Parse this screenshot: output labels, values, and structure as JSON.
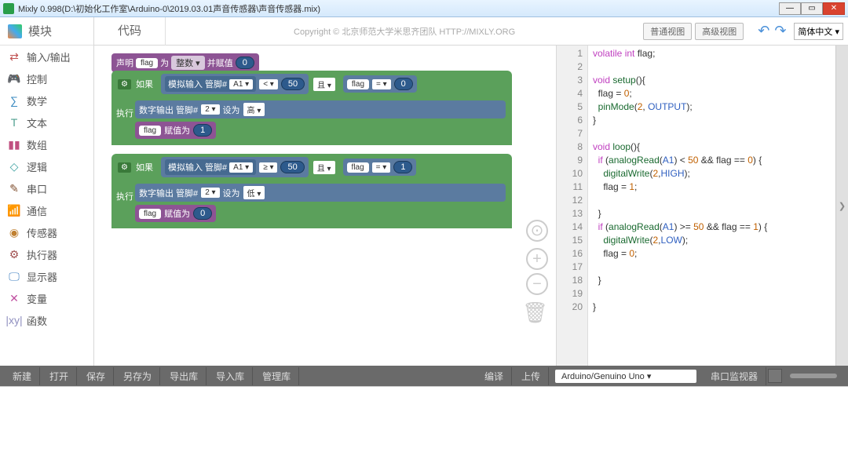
{
  "title": "Mixly 0.998(D:\\初始化工作室\\Arduino-0\\2019.03.01声音传感器\\声音传感器.mix)",
  "sidebar": {
    "header": "模块",
    "items": [
      {
        "label": "输入/输出",
        "color": "#c05050",
        "icon": "⇄"
      },
      {
        "label": "控制",
        "color": "#5ba05b",
        "icon": "🎮"
      },
      {
        "label": "数学",
        "color": "#3a8ac0",
        "icon": "∑"
      },
      {
        "label": "文本",
        "color": "#50a090",
        "icon": "T"
      },
      {
        "label": "数组",
        "color": "#c05080",
        "icon": "▮▮"
      },
      {
        "label": "逻辑",
        "color": "#3aa0a0",
        "icon": "◇"
      },
      {
        "label": "串口",
        "color": "#805030",
        "icon": "✎"
      },
      {
        "label": "通信",
        "color": "#50a050",
        "icon": "📶"
      },
      {
        "label": "传感器",
        "color": "#c08030",
        "icon": "◉"
      },
      {
        "label": "执行器",
        "color": "#a05050",
        "icon": "⚙"
      },
      {
        "label": "显示器",
        "color": "#4080c0",
        "icon": "🖵"
      },
      {
        "label": "变量",
        "color": "#c050a0",
        "icon": "✕"
      },
      {
        "label": "函数",
        "color": "#9090c0",
        "icon": "|xy|"
      }
    ]
  },
  "tabs": {
    "code": "代码"
  },
  "copyright": "Copyright © 北京师范大学米思齐团队 HTTP://MIXLY.ORG",
  "viewbtns": {
    "normal": "普通视图",
    "advanced": "高级视图"
  },
  "lang": "简体中文 ▾",
  "blocks": {
    "decl": {
      "t1": "声明",
      "var": "flag",
      "t2": "为",
      "type": "整数 ▾",
      "t3": "并赋值",
      "val": "0"
    },
    "if": "如果",
    "exec": "执行",
    "analog": {
      "t": "模拟输入 管脚#",
      "pin": "A1 ▾"
    },
    "op1": "< ▾",
    "v50": "50",
    "and": "且 ▾",
    "eq": "= ▾",
    "z": "0",
    "one": "1",
    "ge": "≥ ▾",
    "digout": {
      "t": "数字输出 管脚#",
      "pin": "2 ▾",
      "set": "设为",
      "hi": "高 ▾",
      "lo": "低 ▾"
    },
    "assign": "赋值为",
    "flag": "flag"
  },
  "code_lines": [
    "volatile int flag;",
    "",
    "void setup(){",
    "  flag = 0;",
    "  pinMode(2, OUTPUT);",
    "}",
    "",
    "void loop(){",
    "  if (analogRead(A1) < 50 && flag == 0) {",
    "    digitalWrite(2,HIGH);",
    "    flag = 1;",
    "",
    "  }",
    "  if (analogRead(A1) >= 50 && flag == 1) {",
    "    digitalWrite(2,LOW);",
    "    flag = 0;",
    "",
    "  }",
    "",
    "}"
  ],
  "bottom": {
    "new": "新建",
    "open": "打开",
    "save": "保存",
    "saveas": "另存为",
    "export": "导出库",
    "import": "导入库",
    "manage": "管理库",
    "compile": "编译",
    "upload": "上传",
    "board": "Arduino/Genuino Uno",
    "serial": "串口监视器"
  }
}
